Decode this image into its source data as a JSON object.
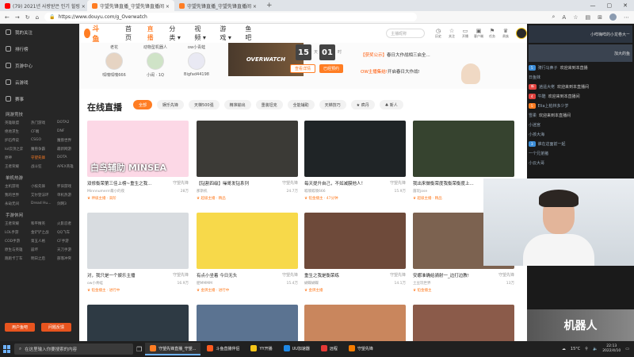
{
  "browser": {
    "tabs": [
      {
        "title": "(79) 2021년 사랑받은 인기 힐링 ×",
        "color": "#ff0000"
      },
      {
        "title": "守望先锋直播_守望先锋直播间 ×",
        "color": "#ff7d23"
      },
      {
        "title": "守望先锋直播_守望先锋直播间 ×",
        "color": "#ff7d23"
      }
    ],
    "new_tab": "+",
    "url": "https://www.douyu.com/g_Overwatch"
  },
  "site": {
    "logo": "斗鱼",
    "nav": [
      "首页",
      "直播",
      "分类 ▾",
      "视频 ▾",
      "游戏 ▾",
      "鱼吧"
    ],
    "search_placeholder": "主播昵称",
    "top_icons": [
      {
        "icon": "◷",
        "label": "历史"
      },
      {
        "icon": "☆",
        "label": "关注"
      },
      {
        "icon": "▭",
        "label": "开播"
      },
      {
        "icon": "▣",
        "label": "客户端"
      },
      {
        "icon": "⚑",
        "label": "任务"
      },
      {
        "icon": "♛",
        "label": "贵族"
      }
    ]
  },
  "sidebar": {
    "top_items": [
      "我的关注",
      "排行榜",
      "页游中心",
      "云游戏",
      "赛事"
    ],
    "sections": [
      {
        "title": "网游竞技",
        "items": [
          "英雄联盟",
          "热门游戏",
          "DOTA2",
          "绝地求生",
          "CF端",
          "DNF",
          "炉石传说",
          "CSGO",
          "魔兽世界",
          "lol云顶之弈",
          "魔兽争霸",
          "最新网游",
          "原神",
          "守望先锋",
          "DOTA",
          "王者荣耀",
          "战斗狂",
          "APEX英雄"
        ]
      },
      {
        "title": "单机热游",
        "items": [
          "主机游戏",
          "小枝先锋",
          "怀旧游戏",
          "我的世界",
          "艾尔登法环",
          "单机热游",
          "永劫无间",
          "Dread Hu...",
          "剑网3"
        ]
      },
      {
        "title": "手游休闲",
        "items": [
          "王者荣耀",
          "和平精英",
          "火影忍者",
          "LOL手游",
          "金铲铲之战",
          "QQ飞车",
          "COD手游",
          "第五人格",
          "CF手游",
          "原生与英雄",
          "崩坏",
          "天刀手游",
          "跑跑卡丁车",
          "明日之后",
          "部落冲突"
        ]
      }
    ],
    "buttons": [
      "用户鱼吧",
      "问题反馈"
    ]
  },
  "strip": {
    "streamers": [
      {
        "name": "老花",
        "sub": "呱噢呱噢666"
      },
      {
        "name": "动物型机器人",
        "sub": "小闹 · 1Q"
      },
      {
        "name": "ow小青蛙",
        "sub": "Bigfad44198"
      }
    ],
    "banner": "OVERWATCH",
    "countdown": [
      {
        "value": "15",
        "unit": "天"
      },
      {
        "value": "01",
        "unit": "时"
      }
    ],
    "buttons": [
      "查看详情",
      "已经预约"
    ],
    "news": [
      {
        "tag": "【获奖公示】",
        "text": "春日大作战相三启全..."
      },
      {
        "tag": "OW主播集结!",
        "text": "开启春日大作战!"
      }
    ]
  },
  "main": {
    "section_title": "在线直播",
    "filters": [
      "全部",
      "娱乐先锋",
      "天梯500强",
      "精准输出",
      "重装坦克",
      "全能辅助",
      "天梯技巧",
      "★ 疯丹",
      "♣ 新人"
    ],
    "cards": [
      {
        "title": "双修衡荣第三佳上榜~重生之我...",
        "category": "守望先锋",
        "streamer": "Minnnumerrr最小的夜",
        "viewers": "28万",
        "tag": "♛ 神级主播 · 高阶",
        "bg": "#fcd8e6",
        "label": "白鸟辅助 MINSEA"
      },
      {
        "title": "【钻割四级】噪哥发钻系列",
        "category": "守望先锋",
        "streamer": "那斯机",
        "viewers": "24.7万",
        "tag": "♛ 超级主播 · 精品",
        "bg": "#3b3a36",
        "label": ""
      },
      {
        "title": "每天提升自己，不如减膜他人！",
        "category": "守望先锋",
        "streamer": "呱噢呱噢666",
        "viewers": "15.9万",
        "tag": "♛ 铂金播主 · 47分钟",
        "bg": "#1f2426",
        "label": ""
      },
      {
        "title": "我出来做衡荣度我衡荣衡度上...",
        "category": "守望先锋",
        "streamer": "菌玩jose",
        "viewers": "",
        "tag": "♛ 超级主播 · 精品",
        "bg": "#36432f",
        "label": ""
      },
      {
        "title": "对，我只是一个娱乐主播",
        "category": "守望先锋",
        "streamer": "ow小青蛙",
        "viewers": "16.9万",
        "tag": "♛ 铂金播主 · 进行中",
        "bg": "#d8dce0",
        "label": ""
      },
      {
        "title": "有点小坐着 今日无头",
        "category": "守望先锋",
        "streamer": "肥MMMM",
        "viewers": "15.4万",
        "tag": "♛ 金牌主播 · 进行中",
        "bg": "#f7d94a",
        "label": ""
      },
      {
        "title": "重生之我是衡荣练",
        "category": "守望先锋",
        "streamer": "蝴蝶蝴蝶",
        "viewers": "14.1万",
        "tag": "♛ 金牌主播",
        "bg": "#6e4a3a",
        "label": ""
      },
      {
        "title": "安娜准确给骑射一_边打边教!",
        "category": "守望先锋",
        "streamer": "土豆玩世界",
        "viewers": "13万",
        "tag": "♛ 铂金播主",
        "bg": "#7c6250",
        "label": ""
      }
    ]
  },
  "chat": {
    "messages": [
      {
        "user": "小咩嗨咩的小龙卷大ㄧ",
        "text": "",
        "badge": "",
        "color": "#555"
      },
      {
        "user": "加大的鱼",
        "text": "",
        "badge": "",
        "color": "#555"
      },
      {
        "user": "骑行马鼻子",
        "text": "欢迎来到本直播",
        "badge": "5",
        "color": "#3c8dd8"
      },
      {
        "user": "日鱼妹",
        "text": "",
        "badge": "",
        "color": "#555"
      },
      {
        "user": "逍遥大佬",
        "text": "欢迎来到本直播间",
        "badge": "新",
        "color": "#e2433f"
      },
      {
        "user": "牛酷",
        "text": "欢迎来到本直播间",
        "badge": "4",
        "color": "#e2433f"
      },
      {
        "user": "Elia上柏林多少岁",
        "text": "",
        "badge": "5",
        "color": "#ff7d23"
      },
      {
        "user": "雪柔",
        "text": "欢迎来到本直播间",
        "badge": "",
        "color": "#555"
      },
      {
        "user": "小迷宫",
        "text": "",
        "badge": "",
        "color": "#555"
      },
      {
        "user": "小孩大海",
        "text": "",
        "badge": "",
        "color": "#555"
      },
      {
        "user": "谁在这面前一起",
        "text": "",
        "badge": "3",
        "color": "#3c8dd8"
      },
      {
        "user": "一个兄弟猪",
        "text": "",
        "badge": "",
        "color": "#555"
      },
      {
        "user": "小云大哥",
        "text": "",
        "badge": "",
        "color": "#555"
      }
    ],
    "banner": "机器人"
  },
  "taskbar": {
    "search_placeholder": "在这里输入你要搜索的内容",
    "tasks": [
      {
        "label": "守望先锋直播_守望...",
        "color": "#ff7d23",
        "on": true
      },
      {
        "label": "斗鱼直播伴侣",
        "color": "#ff5a1f",
        "on": false
      },
      {
        "label": "YY开播",
        "color": "#f5c518",
        "on": false
      },
      {
        "label": "UU加速器",
        "color": "#1e88e5",
        "on": false
      },
      {
        "label": "远程",
        "color": "#e53935",
        "on": false
      },
      {
        "label": "守望先锋",
        "color": "#f57c00",
        "on": false
      }
    ],
    "weather": "15°C",
    "time": "22:13",
    "date": "2022/4/10"
  }
}
